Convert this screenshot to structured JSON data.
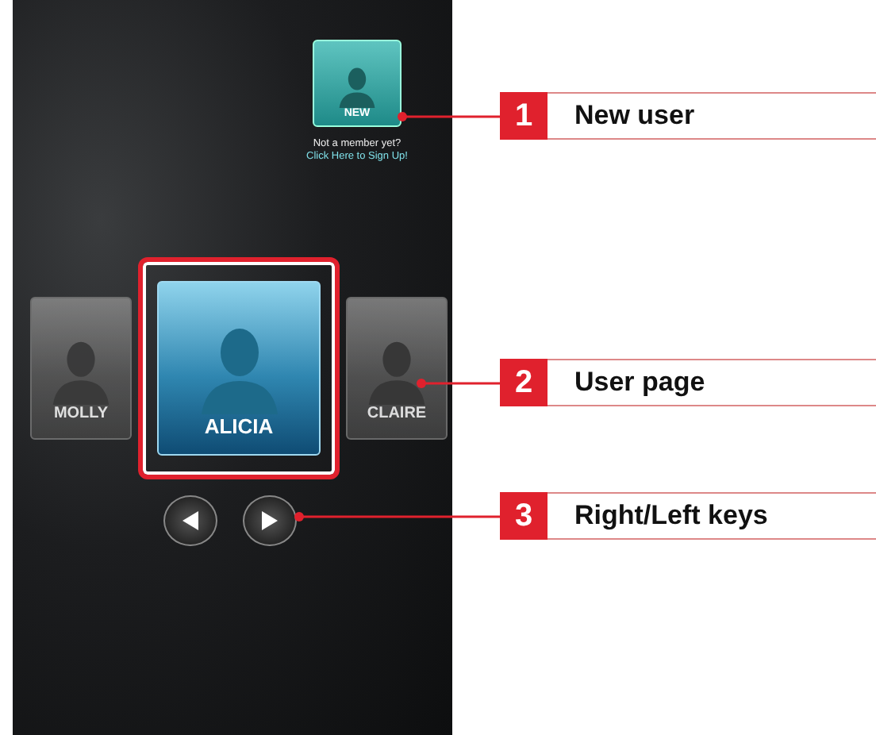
{
  "new_user": {
    "label": "NEW",
    "prompt": "Not a member yet?",
    "link": "Click Here to Sign Up!"
  },
  "users": [
    {
      "name": "MOLLY",
      "selected": false
    },
    {
      "name": "ALICIA",
      "selected": true
    },
    {
      "name": "CLAIRE",
      "selected": false
    }
  ],
  "callouts": [
    {
      "number": "1",
      "label": "New user"
    },
    {
      "number": "2",
      "label": "User page"
    },
    {
      "number": "3",
      "label": "Right/Left keys"
    }
  ]
}
